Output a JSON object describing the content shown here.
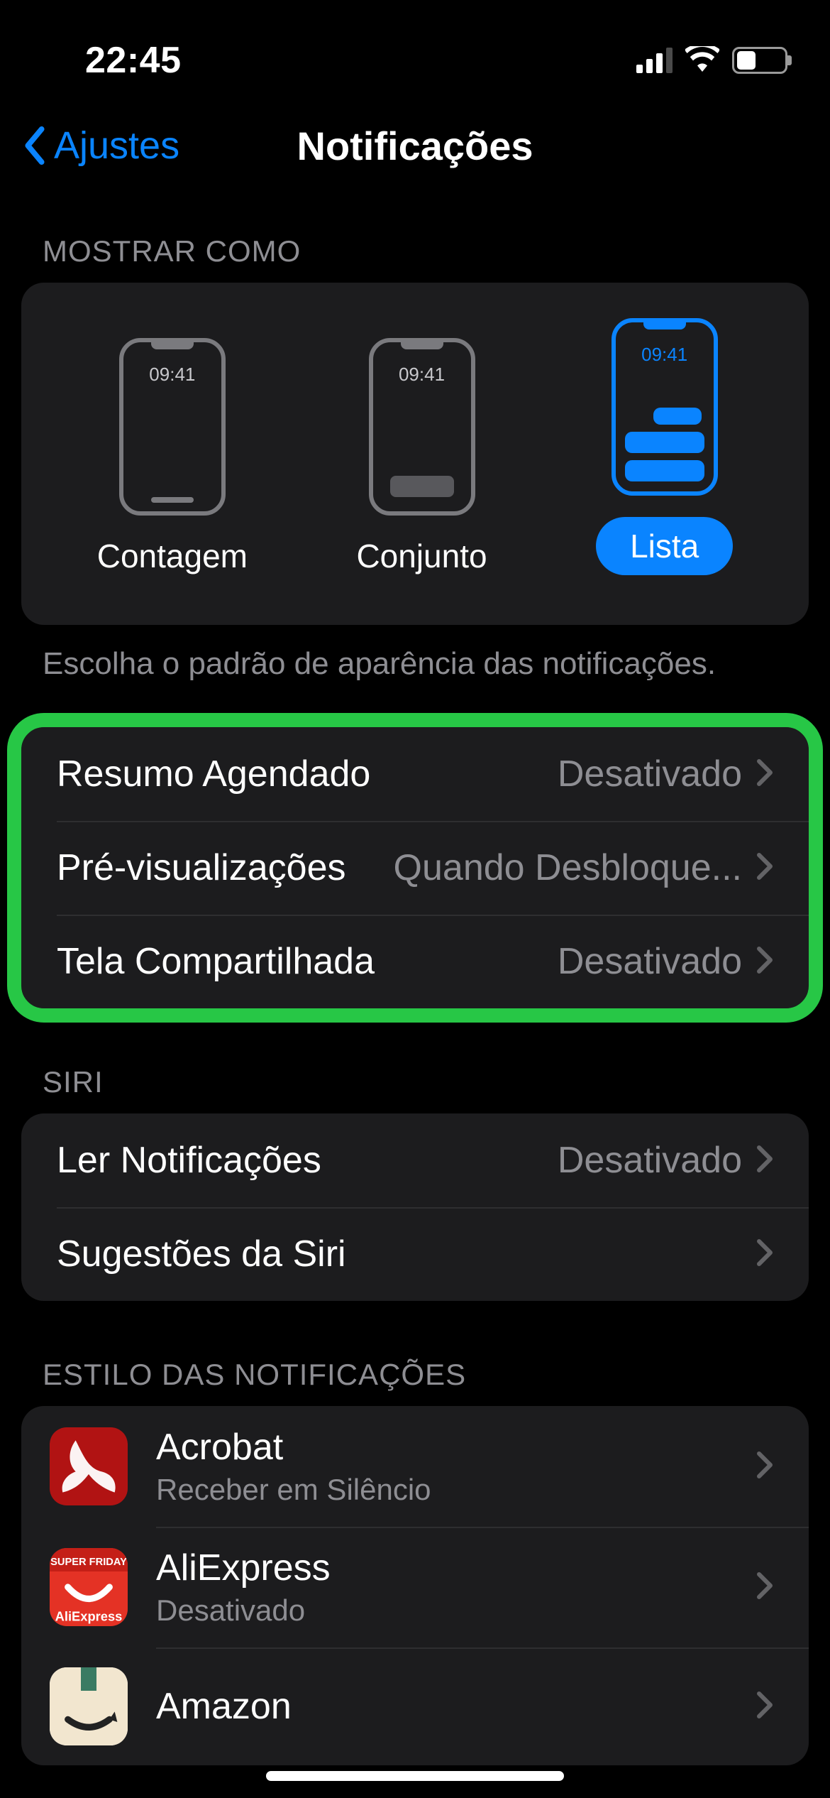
{
  "status": {
    "time": "22:45"
  },
  "nav": {
    "back_label": "Ajustes",
    "title": "Notificações"
  },
  "display_as": {
    "header": "MOSTRAR COMO",
    "sample_time": "09:41",
    "options": {
      "count": "Contagem",
      "stack": "Conjunto",
      "list": "Lista"
    },
    "footer": "Escolha o padrão de aparência das notificações."
  },
  "settings_group": {
    "scheduled_summary": {
      "label": "Resumo Agendado",
      "value": "Desativado"
    },
    "show_previews": {
      "label": "Pré-visualizações",
      "value": "Quando Desbloque..."
    },
    "screen_sharing": {
      "label": "Tela Compartilhada",
      "value": "Desativado"
    }
  },
  "siri": {
    "header": "SIRI",
    "announce": {
      "label": "Ler Notificações",
      "value": "Desativado"
    },
    "suggestions": {
      "label": "Sugestões da Siri"
    }
  },
  "style": {
    "header": "ESTILO DAS NOTIFICAÇÕES",
    "apps": [
      {
        "name": "Acrobat",
        "sub": "Receber em Silêncio"
      },
      {
        "name": "AliExpress",
        "sub": "Desativado"
      },
      {
        "name": "Amazon",
        "sub": ""
      }
    ]
  }
}
